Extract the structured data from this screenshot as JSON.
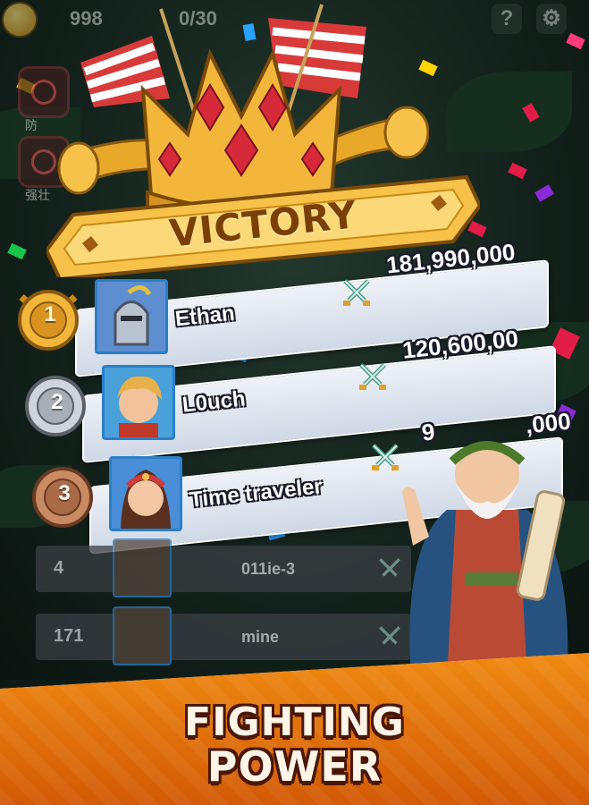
{
  "hud": {
    "coins": "998",
    "energy": "0/30",
    "help_icon": "?",
    "settings_icon": "gear-icon"
  },
  "side_buttons": [
    {
      "label": "防"
    },
    {
      "label": "强壮"
    }
  ],
  "victory": {
    "title": "VICTORY"
  },
  "leaderboard": [
    {
      "rank": "1",
      "name": "Ethan",
      "power": "181,990,000",
      "medal_color": "#e0a12a",
      "frame_color": "#2b7fc6"
    },
    {
      "rank": "2",
      "name": "L0uch",
      "power": "120,600,00",
      "medal_color": "#b9bec4",
      "frame_color": "#2b7fc6"
    },
    {
      "rank": "3",
      "name": "Time traveler",
      "power": "9",
      "power_tail": ",000",
      "medal_color": "#b8724d",
      "frame_color": "#2b7fc6"
    }
  ],
  "other_rows": [
    {
      "rank": "4",
      "name": "011ie-3"
    },
    {
      "rank": "171",
      "name": "mine"
    }
  ],
  "footer": {
    "line1": "FIGHTING",
    "line2": "POWER"
  }
}
